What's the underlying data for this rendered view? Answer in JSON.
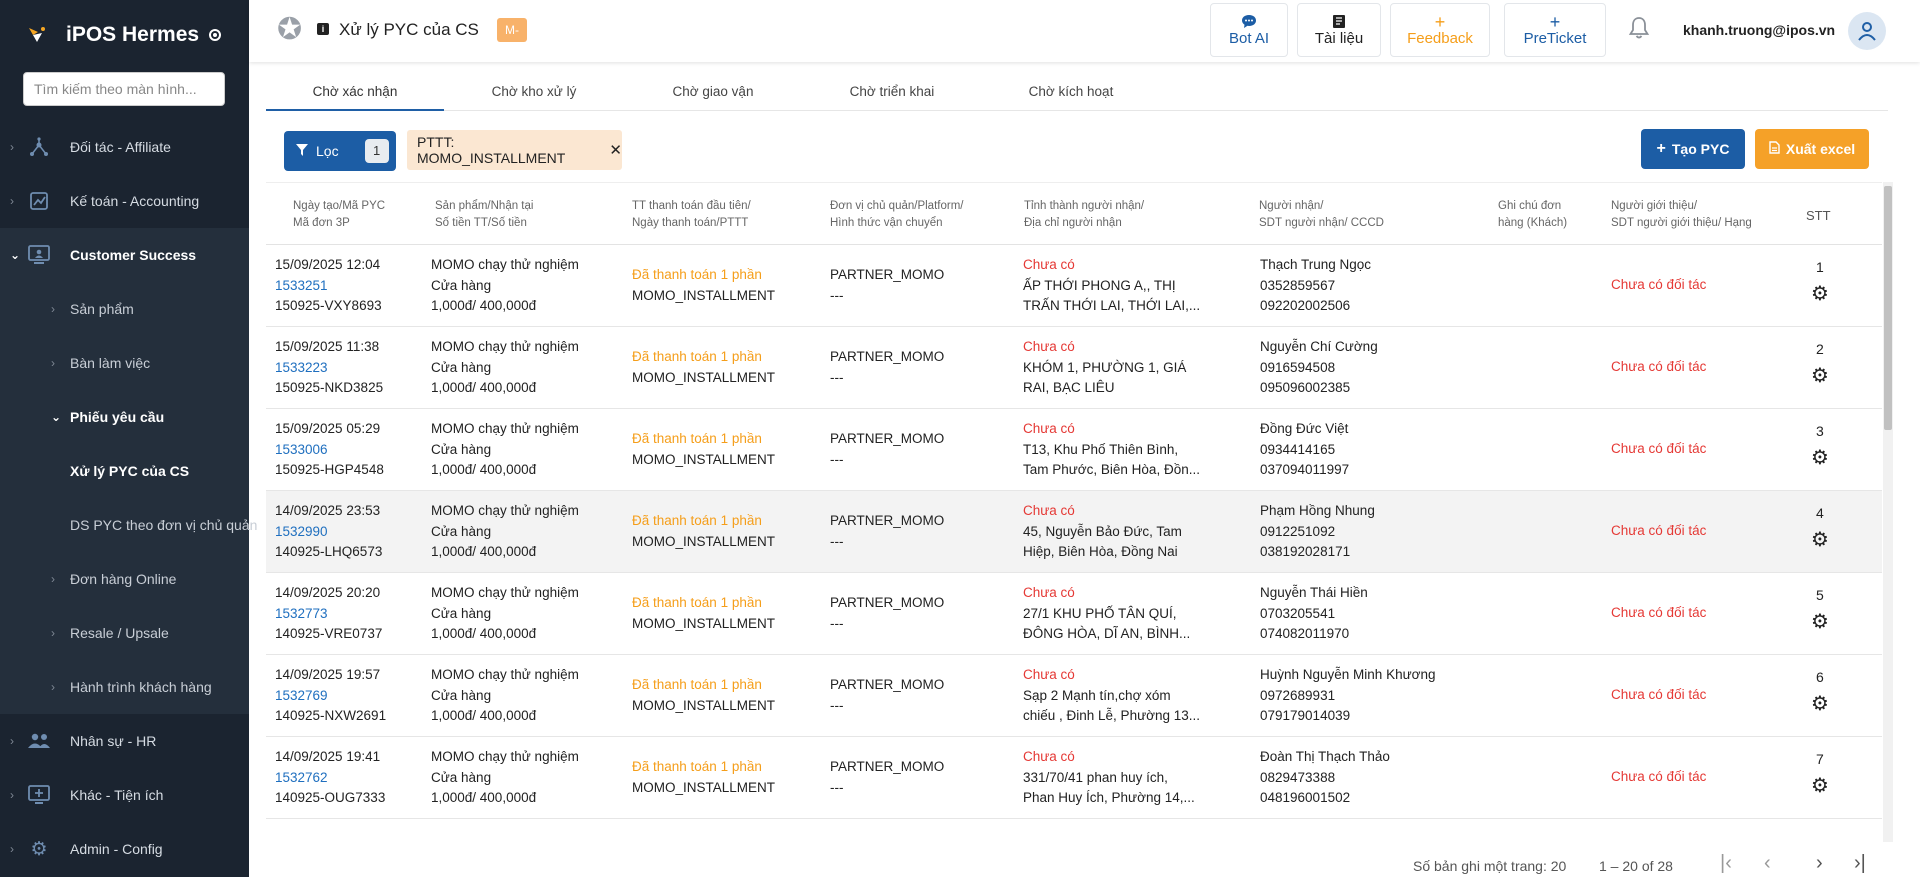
{
  "app": {
    "name": "iPOS Hermes"
  },
  "sidebar": {
    "search_placeholder": "Tìm kiếm theo màn hình...",
    "items": [
      {
        "label": "Đối tác - Affiliate",
        "icon": "network-icon"
      },
      {
        "label": "Kế toán - Accounting",
        "icon": "chart-icon"
      },
      {
        "label": "Customer Success",
        "icon": "monitor-user-icon"
      },
      {
        "label": "Nhân sự - HR",
        "icon": "people-icon"
      },
      {
        "label": "Khác - Tiện ích",
        "icon": "screen-add-icon"
      },
      {
        "label": "Admin - Config",
        "icon": "gear-icon"
      }
    ],
    "sub_items": [
      {
        "label": "Sản phẩm"
      },
      {
        "label": "Bàn làm việc"
      },
      {
        "label": "Phiếu yêu cầu"
      },
      {
        "label": "Xử lý PYC của CS"
      },
      {
        "label": "DS PYC theo đơn vị chủ quản"
      },
      {
        "label": "Đơn hàng Online"
      },
      {
        "label": "Resale / Upsale"
      },
      {
        "label": "Hành trình khách hàng"
      }
    ]
  },
  "header": {
    "title": "Xử lý PYC của CS",
    "badge": "M-",
    "buttons": {
      "bot_ai": "Bot AI",
      "docs": "Tài liệu",
      "feedback": "Feedback",
      "preticket": "PreTicket"
    },
    "plus": "+",
    "user_email": "khanh.truong@ipos.vn"
  },
  "tabs": [
    "Chờ xác nhận",
    "Chờ kho xử lý",
    "Chờ giao vận",
    "Chờ triển khai",
    "Chờ kích hoạt"
  ],
  "filter": {
    "label": "Lọc",
    "count": "1",
    "chip": "PTTT: MOMO_INSTALLMENT",
    "chip_close": "✕",
    "create": "Tạo PYC",
    "export": "Xuất excel"
  },
  "columns": {
    "c1": [
      "Ngày tạo/Mã PYC",
      "Mã đơn 3P"
    ],
    "c2": [
      "Sản phẩm/Nhận tại",
      "Số tiền TT/Số tiền"
    ],
    "c3": [
      "TT thanh toán đầu tiên/",
      "Ngày thanh toán/PTTT"
    ],
    "c4": [
      "Đơn vị chủ quản/Platform/",
      "Hình thức vận chuyển"
    ],
    "c5": [
      "Tỉnh thành người nhận/",
      "Địa chỉ người nhận"
    ],
    "c6": [
      "Người nhận/",
      "SDT người nhận/ CCCD"
    ],
    "c7": [
      "Ghi chú đơn",
      "hàng (Khách)"
    ],
    "c8": [
      "Người giới thiệu/",
      "SDT người giới thiệu/ Hạng"
    ],
    "c9": "STT"
  },
  "rows": [
    {
      "date": "15/09/2025 12:04",
      "code": "1533251",
      "order": "150925-VXY8693",
      "product": "MOMO chạy thử nghiệm",
      "receive": "Cửa hàng",
      "amount": "1,000đ/ 400,000đ",
      "pay_status": "Đã thanh toán 1 phần",
      "method": "MOMO_INSTALLMENT",
      "unit": "PARTNER_MOMO",
      "ship": "---",
      "province": "Chưa có",
      "addr1": "ẤP THỚI PHONG A,, THỊ",
      "addr2": "TRẤN THỚI LAI, THỚI LAI,...",
      "name": "Thạch Trung Ngọc",
      "phone": "0352859567",
      "cccd": "092202002506",
      "referrer": "Chưa có đối tác",
      "stt": "1"
    },
    {
      "date": "15/09/2025 11:38",
      "code": "1533223",
      "order": "150925-NKD3825",
      "product": "MOMO chạy thử nghiệm",
      "receive": "Cửa hàng",
      "amount": "1,000đ/ 400,000đ",
      "pay_status": "Đã thanh toán 1 phần",
      "method": "MOMO_INSTALLMENT",
      "unit": "PARTNER_MOMO",
      "ship": "---",
      "province": "Chưa có",
      "addr1": "KHÓM 1, PHƯỜNG 1, GIÁ",
      "addr2": "RAI, BẠC LIÊU",
      "name": "Nguyễn Chí Cường",
      "phone": "0916594508",
      "cccd": "095096002385",
      "referrer": "Chưa có đối tác",
      "stt": "2"
    },
    {
      "date": "15/09/2025 05:29",
      "code": "1533006",
      "order": "150925-HGP4548",
      "product": "MOMO chạy thử nghiệm",
      "receive": "Cửa hàng",
      "amount": "1,000đ/ 400,000đ",
      "pay_status": "Đã thanh toán 1 phần",
      "method": "MOMO_INSTALLMENT",
      "unit": "PARTNER_MOMO",
      "ship": "---",
      "province": "Chưa có",
      "addr1": "T13, Khu Phố Thiên Bình,",
      "addr2": "Tam Phước, Biên Hòa, Đồn...",
      "name": "Đồng Đức Việt",
      "phone": "0934414165",
      "cccd": "037094011997",
      "referrer": "Chưa có đối tác",
      "stt": "3"
    },
    {
      "date": "14/09/2025 23:53",
      "code": "1532990",
      "order": "140925-LHQ6573",
      "product": "MOMO chạy thử nghiệm",
      "receive": "Cửa hàng",
      "amount": "1,000đ/ 400,000đ",
      "pay_status": "Đã thanh toán 1 phần",
      "method": "MOMO_INSTALLMENT",
      "unit": "PARTNER_MOMO",
      "ship": "---",
      "province": "Chưa có",
      "addr1": "45, Nguyễn Bảo Đức, Tam",
      "addr2": "Hiệp, Biên Hòa, Đồng Nai",
      "name": "Phạm Hồng Nhung",
      "phone": "0912251092",
      "cccd": "038192028171",
      "referrer": "Chưa có đối tác",
      "stt": "4"
    },
    {
      "date": "14/09/2025 20:20",
      "code": "1532773",
      "order": "140925-VRE0737",
      "product": "MOMO chạy thử nghiệm",
      "receive": "Cửa hàng",
      "amount": "1,000đ/ 400,000đ",
      "pay_status": "Đã thanh toán 1 phần",
      "method": "MOMO_INSTALLMENT",
      "unit": "PARTNER_MOMO",
      "ship": "---",
      "province": "Chưa có",
      "addr1": "27/1 KHU PHỐ TÂN QUÍ,",
      "addr2": "ĐÔNG HÒA, DĨ AN, BÌNH...",
      "name": "Nguyễn Thái Hiền",
      "phone": "0703205541",
      "cccd": "074082011970",
      "referrer": "Chưa có đối tác",
      "stt": "5"
    },
    {
      "date": "14/09/2025 19:57",
      "code": "1532769",
      "order": "140925-NXW2691",
      "product": "MOMO chạy thử nghiệm",
      "receive": "Cửa hàng",
      "amount": "1,000đ/ 400,000đ",
      "pay_status": "Đã thanh toán 1 phần",
      "method": "MOMO_INSTALLMENT",
      "unit": "PARTNER_MOMO",
      "ship": "---",
      "province": "Chưa có",
      "addr1": "Sạp 2 Mạnh tín,chợ xóm",
      "addr2": "chiếu , Đinh Lễ, Phường 13...",
      "name": "Huỳnh Nguyễn Minh Khương",
      "phone": "0972689931",
      "cccd": "079179014039",
      "referrer": "Chưa có đối tác",
      "stt": "6"
    },
    {
      "date": "14/09/2025 19:41",
      "code": "1532762",
      "order": "140925-OUG7333",
      "product": "MOMO chạy thử nghiệm",
      "receive": "Cửa hàng",
      "amount": "1,000đ/ 400,000đ",
      "pay_status": "Đã thanh toán 1 phần",
      "method": "MOMO_INSTALLMENT",
      "unit": "PARTNER_MOMO",
      "ship": "---",
      "province": "Chưa có",
      "addr1": "331/70/41 phan huy ích,",
      "addr2": "Phan Huy Ích, Phường 14,...",
      "name": "Đoàn Thị Thạch Thảo",
      "phone": "0829473388",
      "cccd": "048196001502",
      "referrer": "Chưa có đối tác",
      "stt": "7"
    }
  ],
  "pagination": {
    "per_page_label": "Số bản ghi một trang: 20",
    "range": "1 – 20 of 28"
  }
}
